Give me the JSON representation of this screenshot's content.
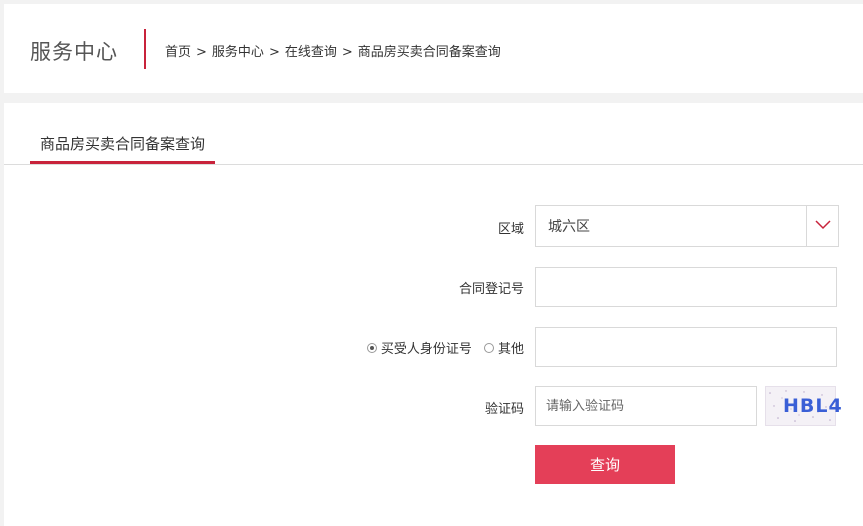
{
  "header": {
    "section_title": "服务中心",
    "breadcrumb": [
      {
        "label": "首页"
      },
      {
        "label": "服务中心"
      },
      {
        "label": "在线查询"
      },
      {
        "label": "商品房买卖合同备案查询"
      }
    ],
    "separator": ">"
  },
  "tabs": [
    {
      "label": "商品房买卖合同备案查询",
      "active": true
    }
  ],
  "form": {
    "district": {
      "label": "区域",
      "value": "城六区"
    },
    "contract_no": {
      "label": "合同登记号",
      "value": ""
    },
    "id_type": {
      "options": [
        {
          "label": "买受人身份证号",
          "checked": true
        },
        {
          "label": "其他",
          "checked": false
        }
      ],
      "value": ""
    },
    "captcha": {
      "label": "验证码",
      "placeholder": "请输入验证码",
      "image_text": "HBL4"
    },
    "submit_label": "查询"
  },
  "colors": {
    "accent": "#c8233b",
    "button": "#e43f58"
  }
}
